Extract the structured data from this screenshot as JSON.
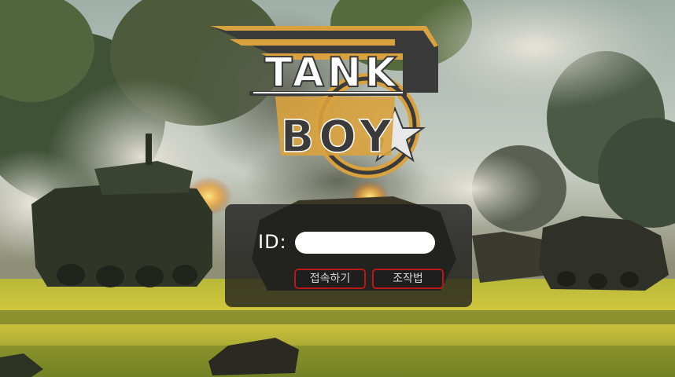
{
  "logo": {
    "line1": "TANK",
    "line2": "BOY"
  },
  "login": {
    "id_label": "ID:",
    "id_value": "",
    "connect_label": "접속하기",
    "howto_label": "조작법"
  },
  "colors": {
    "logo_gold": "#d9a23e",
    "logo_dark": "#3a3a3a",
    "button_border": "#b81818",
    "panel_bg": "rgba(28,28,28,0.78)"
  }
}
